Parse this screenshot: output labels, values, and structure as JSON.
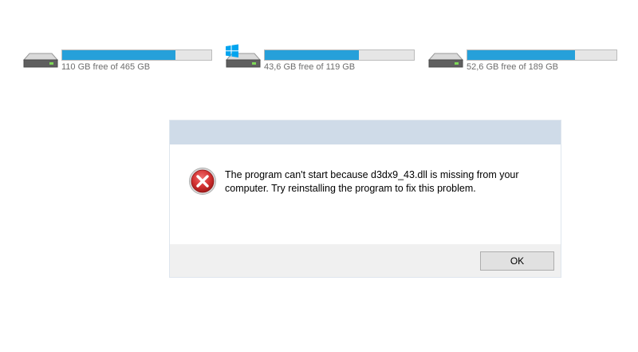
{
  "drives": [
    {
      "label": "110 GB free of 465 GB",
      "used_fraction": 0.76,
      "icon": "hard-drive-icon",
      "system": false
    },
    {
      "label": "43,6 GB free of 119 GB",
      "used_fraction": 0.63,
      "icon": "hard-drive-icon",
      "system": true
    },
    {
      "label": "52,6 GB free of 189 GB",
      "used_fraction": 0.72,
      "icon": "hard-drive-icon",
      "system": false
    }
  ],
  "dialog": {
    "title": "",
    "message": "The program can't start because d3dx9_43.dll is missing from your computer. Try reinstalling the program to fix this problem.",
    "ok_label": "OK",
    "icon": "error-icon"
  },
  "colors": {
    "bar_fill": "#26a0da",
    "titlebar": "#cfdbe8",
    "footer": "#f0f0f0",
    "error_red": "#c42b2b",
    "windows_logo": "#00a4ef"
  }
}
